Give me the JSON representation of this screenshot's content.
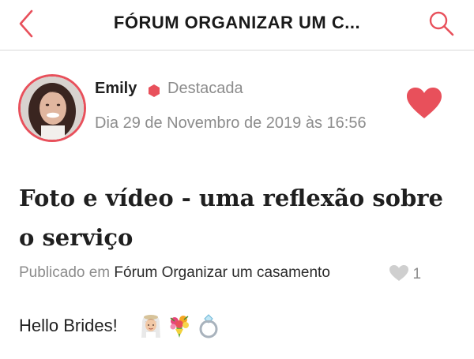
{
  "header": {
    "title": "FÓRUM ORGANIZAR UM C...",
    "back_icon": "chevron-left-icon",
    "search_icon": "search-icon",
    "accent_color": "#e8505b"
  },
  "post": {
    "author": {
      "name": "Emily",
      "badge_label": "Destacada",
      "badge_icon": "hexagon-icon",
      "avatar": "avatar-photo"
    },
    "date": "Dia 29 de Novembro de 2019 às 16:56",
    "liked_icon": "heart-filled-icon",
    "title": "Foto e vídeo - uma reflexão sobre o serviço",
    "published_prefix": "Publicado em",
    "forum_name": "Fórum Organizar um casamento",
    "like_count": "1",
    "body_text": "Hello Brides!",
    "body_emojis": [
      "bride-emoji",
      "bouquet-emoji",
      "ring-emoji"
    ]
  },
  "colors": {
    "accent": "#e8505b",
    "muted_text": "#8c8c8c",
    "text": "#1f1f1f"
  }
}
